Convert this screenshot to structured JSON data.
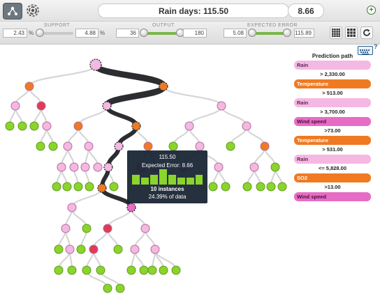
{
  "header": {
    "title": "Rain days: 115.50",
    "value": "8.66",
    "expand_symbol": "+",
    "views": [
      {
        "id": "tree",
        "icon": "tree-view-icon",
        "active": true
      },
      {
        "id": "sunburst",
        "icon": "sunburst-view-icon",
        "active": false
      }
    ]
  },
  "filters": {
    "support": {
      "label": "SUPPORT",
      "min": "2.43",
      "max": "4.88",
      "unit": "%"
    },
    "output": {
      "label": "OUTPUT",
      "min": "36",
      "max": "180"
    },
    "expected_error": {
      "label": "EXPECTED ERROR",
      "min": "5.08",
      "max": "115.89"
    },
    "tools": [
      {
        "name": "dense-grid-icon"
      },
      {
        "name": "grid-icon"
      },
      {
        "name": "refresh-icon"
      }
    ]
  },
  "tooltip": {
    "value": "115.50",
    "expected_error": "Expected Error: 8.66",
    "instances": "10 instances",
    "percent": "24.39% of data"
  },
  "prediction_path": {
    "title": "Prediction path",
    "steps": [
      {
        "field": "Rain",
        "kind": "pink",
        "condition": "> 2,330.00"
      },
      {
        "field": "Temperature",
        "kind": "orange",
        "condition": "> 513.00"
      },
      {
        "field": "Rain",
        "kind": "pink",
        "condition": "> 3,700.00"
      },
      {
        "field": "Wind speed",
        "kind": "magenta",
        "condition": ">73.00"
      },
      {
        "field": "Temperature",
        "kind": "orange",
        "condition": "> 531.00"
      },
      {
        "field": "Rain",
        "kind": "pink",
        "condition": "<= 5,828.00"
      },
      {
        "field": "SO2",
        "kind": "orange",
        "condition": ">13.00"
      },
      {
        "field": "Wind speed",
        "kind": "magenta",
        "condition": ""
      }
    ]
  },
  "colors": {
    "rain": "#f4b8e2",
    "temperature": "#f07a22",
    "wind_speed": "#e76cc4",
    "so2": "#f07a22",
    "humidity": "#e23a55",
    "leaf": "#8bd42c",
    "path": "#2b2d30",
    "accent_green": "#7ab648"
  }
}
